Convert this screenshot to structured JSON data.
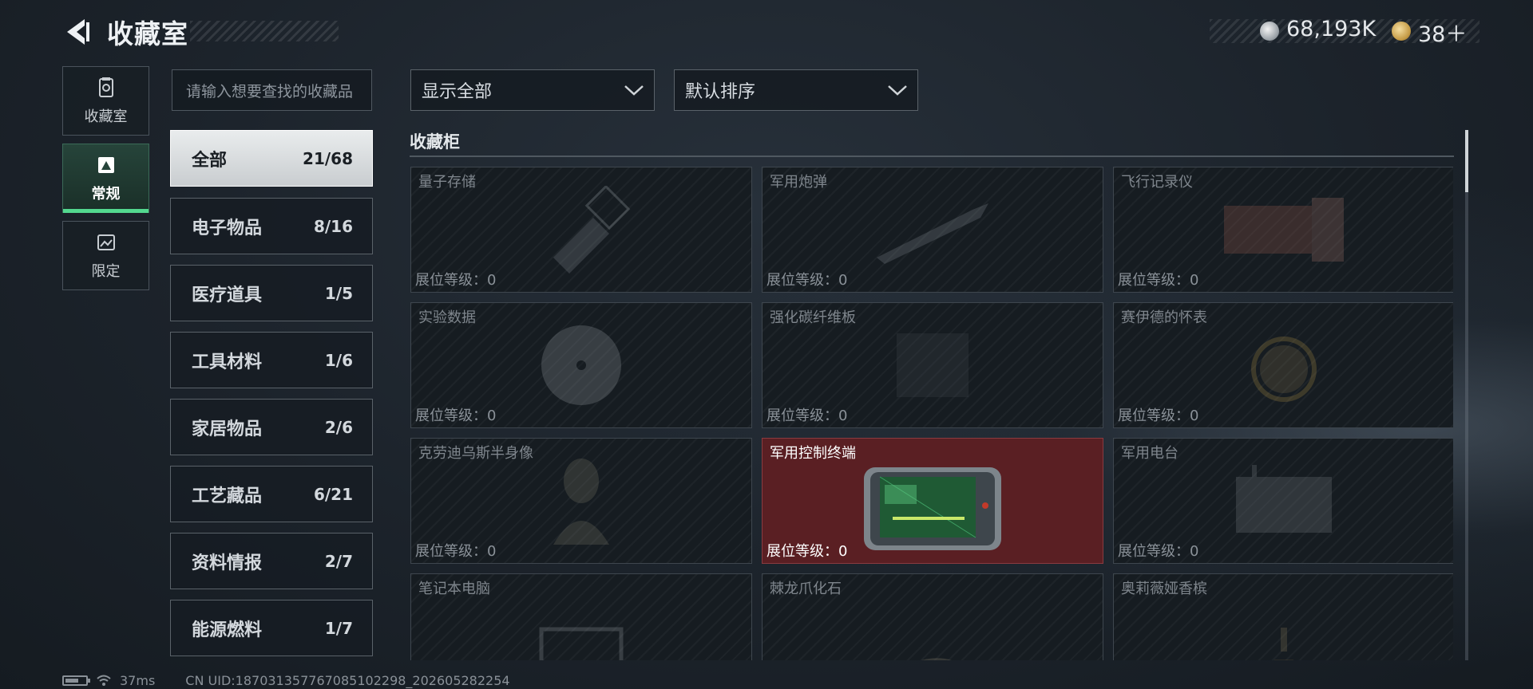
{
  "header": {
    "title": "收藏室",
    "currency_silver": "68,193K",
    "currency_gold": "38＋"
  },
  "sidebar": {
    "tabs": [
      {
        "label": "收藏室",
        "icon": "collection-room-icon",
        "active": false
      },
      {
        "label": "常规",
        "icon": "regular-icon",
        "active": true
      },
      {
        "label": "限定",
        "icon": "limited-icon",
        "active": false
      }
    ]
  },
  "search": {
    "placeholder": "请输入想要查找的收藏品"
  },
  "categories": [
    {
      "name": "全部",
      "count": "21/68",
      "active": true
    },
    {
      "name": "电子物品",
      "count": "8/16"
    },
    {
      "name": "医疗道具",
      "count": "1/5"
    },
    {
      "name": "工具材料",
      "count": "1/6"
    },
    {
      "name": "家居物品",
      "count": "2/6"
    },
    {
      "name": "工艺藏品",
      "count": "6/21"
    },
    {
      "name": "资料情报",
      "count": "2/7"
    },
    {
      "name": "能源燃料",
      "count": "1/7"
    }
  ],
  "filters": {
    "display": "显示全部",
    "sort": "默认排序"
  },
  "section_title": "收藏柜",
  "items": [
    {
      "name": "量子存储",
      "level": "展位等级：0",
      "icon": "usb-drive-icon"
    },
    {
      "name": "军用炮弹",
      "level": "展位等级：0",
      "icon": "artillery-shell-icon"
    },
    {
      "name": "飞行记录仪",
      "level": "展位等级：0",
      "icon": "flight-recorder-icon"
    },
    {
      "name": "实验数据",
      "level": "展位等级：0",
      "icon": "data-disc-icon"
    },
    {
      "name": "强化碳纤维板",
      "level": "展位等级：0",
      "icon": "carbon-plate-icon"
    },
    {
      "name": "赛伊德的怀表",
      "level": "展位等级：0",
      "icon": "pocket-watch-icon"
    },
    {
      "name": "克劳迪乌斯半身像",
      "level": "展位等级：0",
      "icon": "bust-statue-icon"
    },
    {
      "name": "军用控制终端",
      "level": "展位等级：0",
      "icon": "control-terminal-icon",
      "highlighted": true
    },
    {
      "name": "军用电台",
      "level": "展位等级：0",
      "icon": "radio-icon"
    },
    {
      "name": "笔记本电脑",
      "level": "",
      "icon": "laptop-icon"
    },
    {
      "name": "棘龙爪化石",
      "level": "",
      "icon": "claw-fossil-icon"
    },
    {
      "name": "奥莉薇娅香槟",
      "level": "",
      "icon": "champagne-icon"
    }
  ],
  "status": {
    "ping": "37ms",
    "uid": "CN UID:187031357767085102298_202605282254"
  }
}
